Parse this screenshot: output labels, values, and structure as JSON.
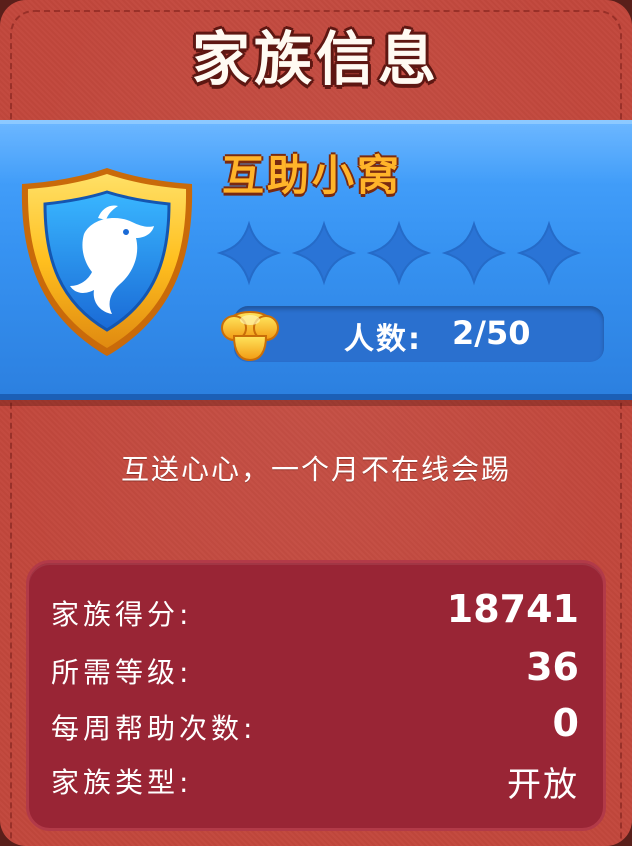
{
  "header": {
    "title": "家族信息"
  },
  "family": {
    "name": "互助小窝",
    "emblem_icon": "dolphin-shield-icon",
    "stars_total": 5,
    "stars_filled": 0,
    "member_label": "人数:",
    "member_value": "2/50",
    "bell_icon": "golden-bell-icon",
    "description": "互送心心，一个月不在线会踢"
  },
  "stats": {
    "score_label": "家族得分:",
    "score_value": "18741",
    "level_label": "所需等级:",
    "level_value": "36",
    "help_label": "每周帮助次数:",
    "help_value": "0",
    "type_label": "家族类型:",
    "type_value": "开放"
  },
  "colors": {
    "background": "#c2473c",
    "banner": "#3793f2",
    "name": "#ffb42a",
    "stats_panel": "#992535"
  }
}
